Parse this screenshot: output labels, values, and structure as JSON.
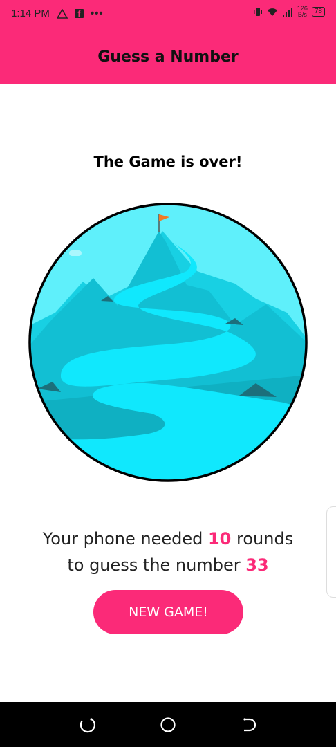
{
  "status_bar": {
    "time": "1:14 PM",
    "dots": "•••",
    "speed_value": "126",
    "speed_unit": "B/s",
    "battery": "78"
  },
  "app_bar": {
    "title": "Guess a Number"
  },
  "game_over": {
    "title": "The Game is over!",
    "message_prefix": "Your phone needed ",
    "rounds": "10",
    "message_middle": " rounds",
    "message_line2_prefix": "to guess the number ",
    "number": "33"
  },
  "new_game_button": {
    "label": "NEW GAME!"
  },
  "colors": {
    "accent": "#fb2a78",
    "sky": "#5ff0fb",
    "path": "#10e8fd"
  },
  "icons": {
    "navigation": [
      "recents-icon",
      "home-icon",
      "back-icon"
    ]
  }
}
